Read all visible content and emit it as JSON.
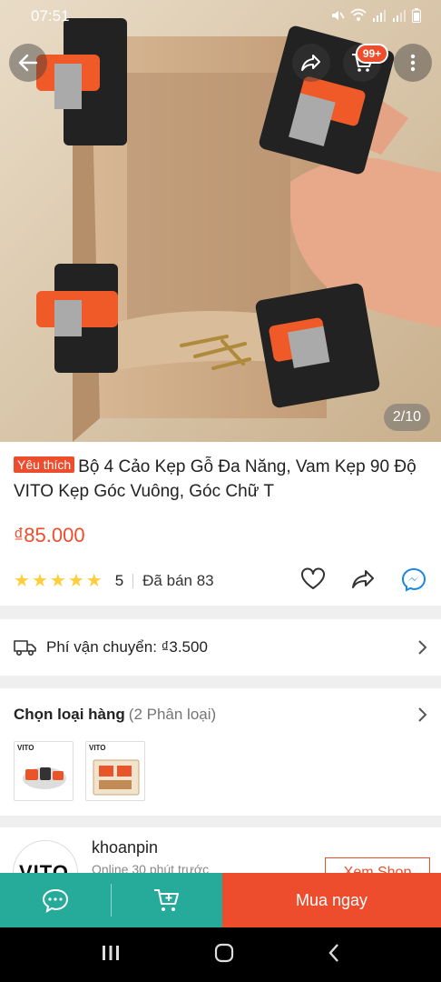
{
  "status_bar": {
    "time": "07:51"
  },
  "header": {
    "cart_badge": "99+"
  },
  "gallery": {
    "counter": "2/10"
  },
  "product": {
    "favorite_tag": "Yêu thích",
    "title": "Bộ 4 Cảo Kẹp Gỗ Đa Năng, Vam Kẹp 90 Độ VITO Kẹp Góc Vuông, Góc Chữ T",
    "price": "₫85.000",
    "rating": "5",
    "rating_stars": 5,
    "sold": "Đã bán 83"
  },
  "shipping": {
    "label": "Phí vận chuyển: ₫3.500"
  },
  "variants": {
    "title": "Chọn loại hàng",
    "count": "(2 Phân loại)",
    "thumbs": [
      {
        "brand": "VITO"
      },
      {
        "brand": "VITO"
      }
    ]
  },
  "shop": {
    "logo_text": "VITO",
    "name": "khoanpin",
    "status": "Online 30 phút trước",
    "view_button": "Xem Shop"
  },
  "bottom_bar": {
    "buy_now": "Mua ngay"
  },
  "colors": {
    "brand": "#ee4d2d",
    "teal": "#26aa99",
    "star": "#ffce3d",
    "messenger": "#1a86e8"
  }
}
